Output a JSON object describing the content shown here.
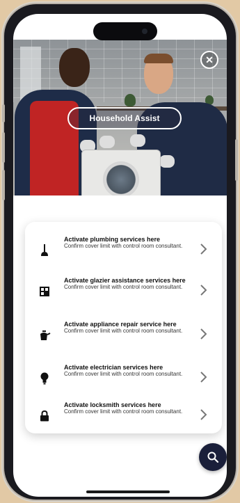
{
  "hero": {
    "title": "Household Assist",
    "close_icon": "close-icon"
  },
  "services": [
    {
      "icon": "plunger-icon",
      "title": "Activate plumbing services here",
      "subtitle": "Confirm cover limit with control room consultant."
    },
    {
      "icon": "window-icon",
      "title": "Activate glazier assistance services here",
      "subtitle": "Confirm cover limit with control room consultant."
    },
    {
      "icon": "kettle-icon",
      "title": "Activate appliance repair service here",
      "subtitle": "Confirm cover limit with control room consultant."
    },
    {
      "icon": "lightbulb-icon",
      "title": "Activate electrician services here",
      "subtitle": "Confirm cover limit with control room consultant."
    },
    {
      "icon": "lock-icon",
      "title": "Activate locksmith services here",
      "subtitle": "Confirm cover limit with control room consultant."
    }
  ],
  "fab": {
    "icon": "search-icon"
  },
  "colors": {
    "background": "#e2c9a5",
    "fab": "#1a1f3a",
    "card": "#ffffff"
  }
}
